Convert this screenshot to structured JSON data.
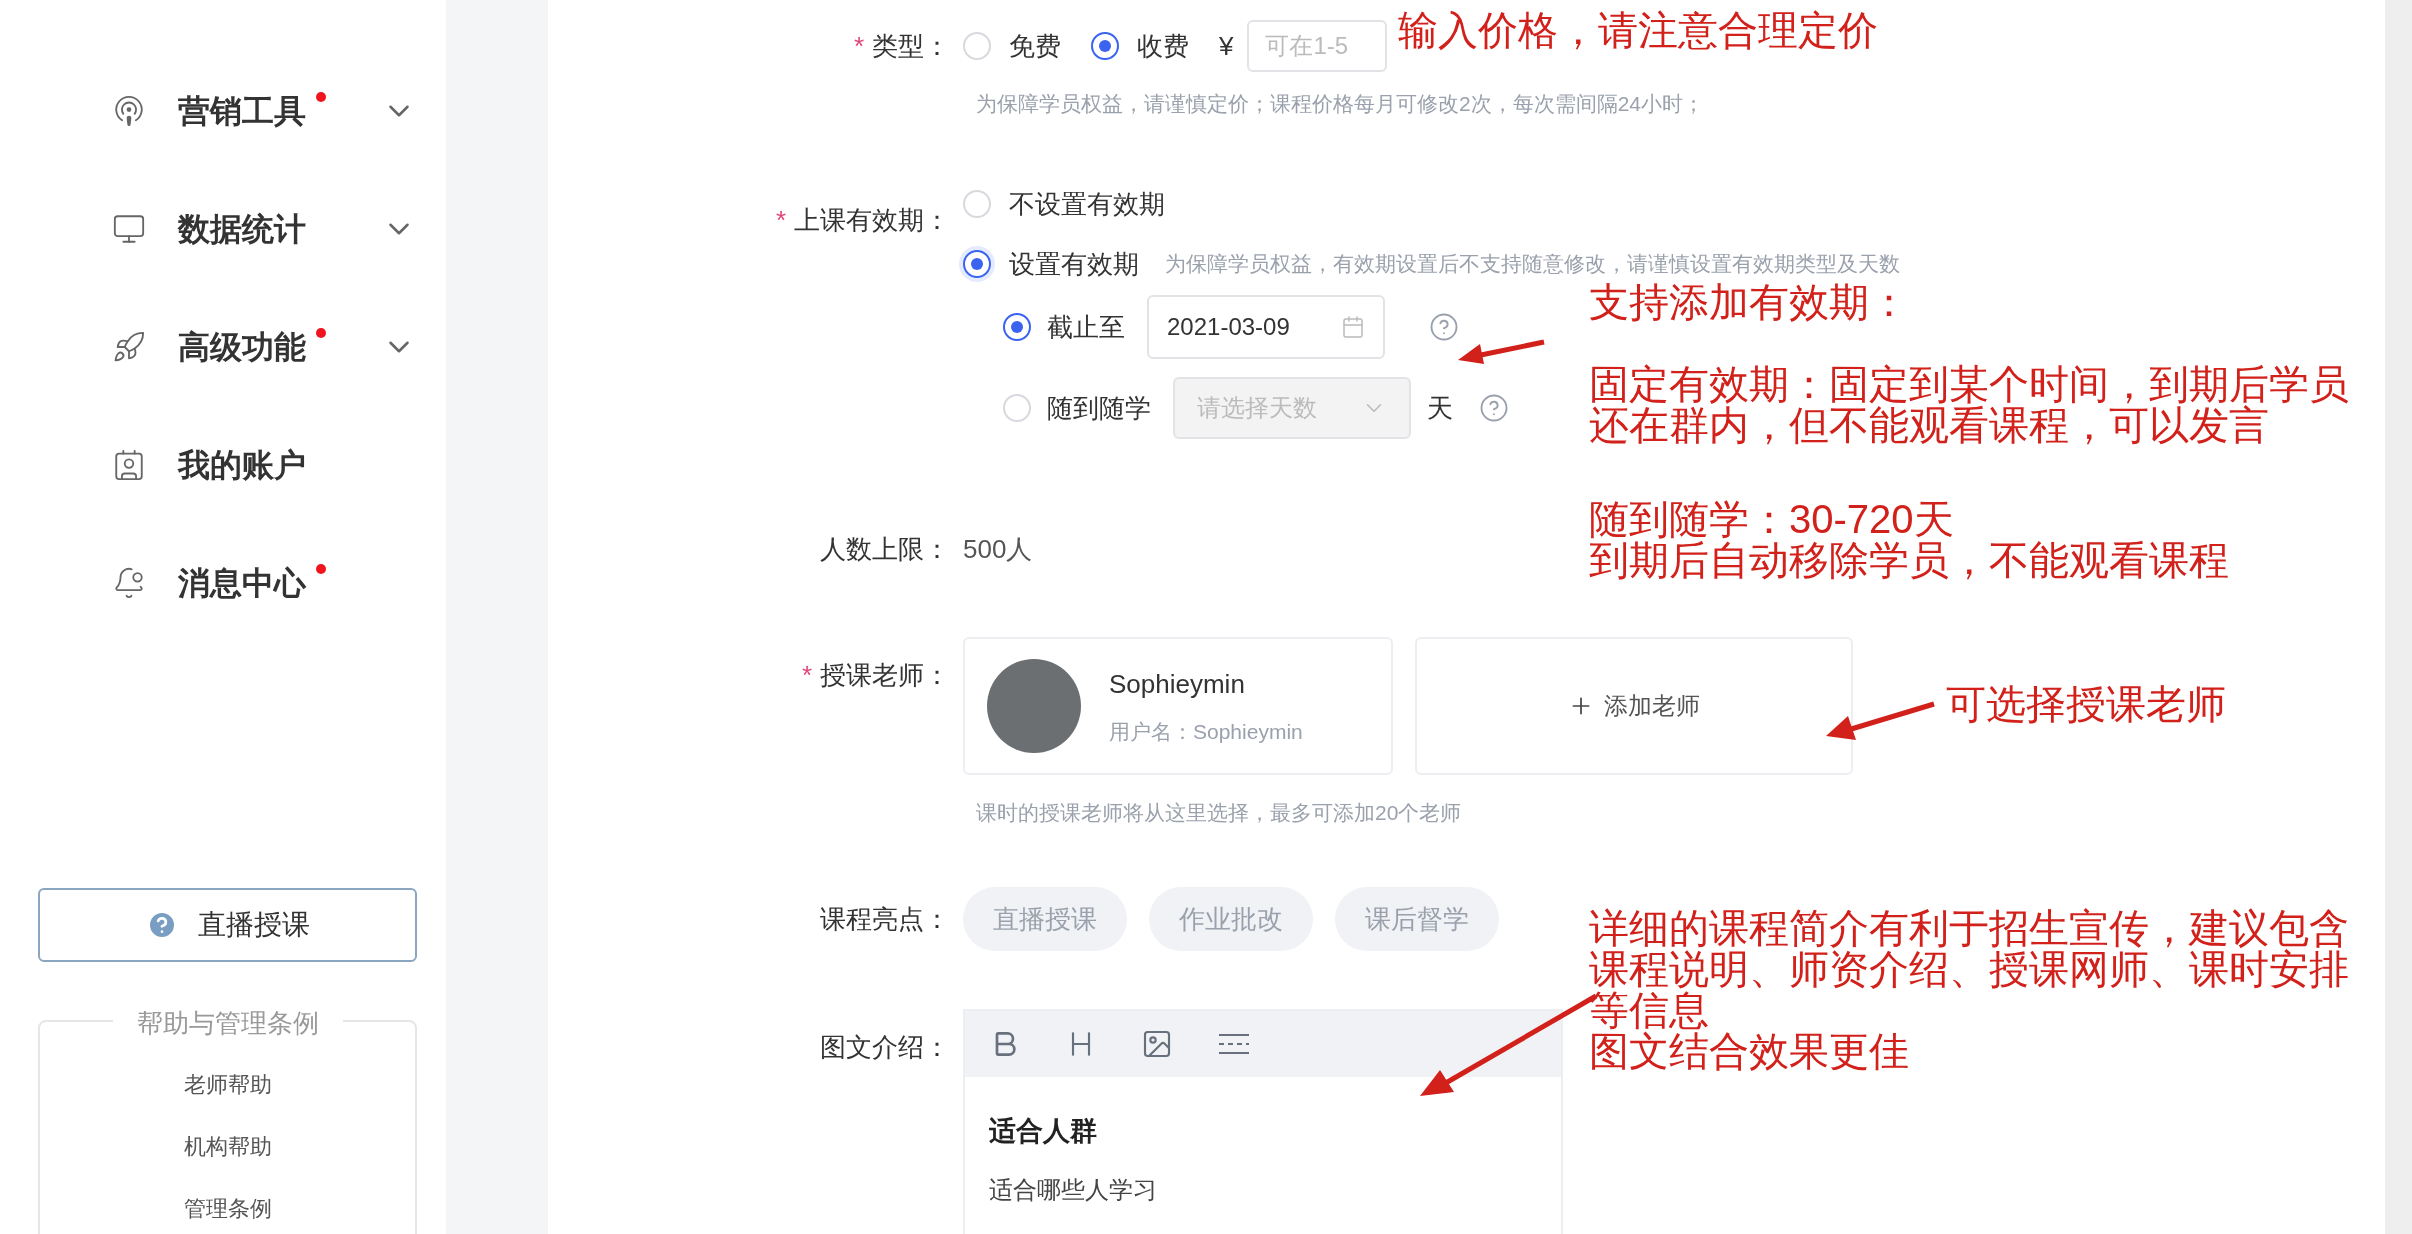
{
  "sidebar": {
    "items": [
      {
        "label": "营销工具",
        "badge": true,
        "expandable": true
      },
      {
        "label": "数据统计",
        "badge": false,
        "expandable": true
      },
      {
        "label": "高级功能",
        "badge": true,
        "expandable": true
      },
      {
        "label": "我的账户",
        "badge": false,
        "expandable": false
      },
      {
        "label": "消息中心",
        "badge": true,
        "expandable": false
      }
    ],
    "live_button": "直播授课",
    "help": {
      "title": "帮助与管理条例",
      "links": [
        "老师帮助",
        "机构帮助",
        "管理条例"
      ]
    }
  },
  "form": {
    "type": {
      "mark": "*",
      "label": "类型：",
      "options": [
        {
          "label": "免费",
          "selected": false
        },
        {
          "label": "收费",
          "selected": true
        }
      ],
      "currency": "¥",
      "price": {
        "placeholder": "可在1-5"
      },
      "hint": "为保障学员权益，请谨慎定价；课程价格每月可修改2次，每次需间隔24小时；"
    },
    "validity": {
      "mark": "*",
      "label": "上课有效期：",
      "options": [
        {
          "label": "不设置有效期",
          "selected": false
        },
        {
          "label": "设置有效期",
          "selected": true,
          "hint": "为保障学员权益，有效期设置后不支持随意修改，请谨慎设置有效期类型及天数"
        }
      ],
      "sub_options": [
        {
          "kind": "date",
          "label": "截止至",
          "selected": true,
          "value": "2021-03-09"
        },
        {
          "kind": "days",
          "label": "随到随学",
          "selected": false,
          "placeholder": "请选择天数",
          "unit": "天"
        }
      ]
    },
    "capacity": {
      "label": "人数上限：",
      "value": "500人"
    },
    "teachers": {
      "mark": "*",
      "label": "授课老师：",
      "items": [
        {
          "name": "Sophieymin",
          "username": "用户名：Sophieymin"
        }
      ],
      "add_button": "添加老师",
      "hint": "课时的授课老师将从这里选择，最多可添加20个老师"
    },
    "highlights": {
      "label": "课程亮点：",
      "tags": [
        "直播授课",
        "作业批改",
        "课后督学"
      ]
    },
    "intro": {
      "label": "图文介绍：",
      "heading": "适合人群",
      "body": "适合哪些人学习"
    }
  },
  "annotations": [
    {
      "lines": [
        "输入价格，请注意合理定价"
      ]
    },
    {
      "lines": [
        "支持添加有效期："
      ]
    },
    {
      "lines": [
        "固定有效期：固定到某个时间，到期后学员",
        "还在群内，但不能观看课程，可以发言"
      ]
    },
    {
      "lines": [
        "随到随学：30-720天",
        "到期后自动移除学员，不能观看课程"
      ]
    },
    {
      "lines": [
        "可选择授课老师"
      ]
    },
    {
      "lines": [
        "详细的课程简介有利于招生宣传，建议包含",
        "课程说明、师资介绍、授课网师、课时安排",
        "等信息",
        "图文结合效果更佳"
      ]
    }
  ]
}
